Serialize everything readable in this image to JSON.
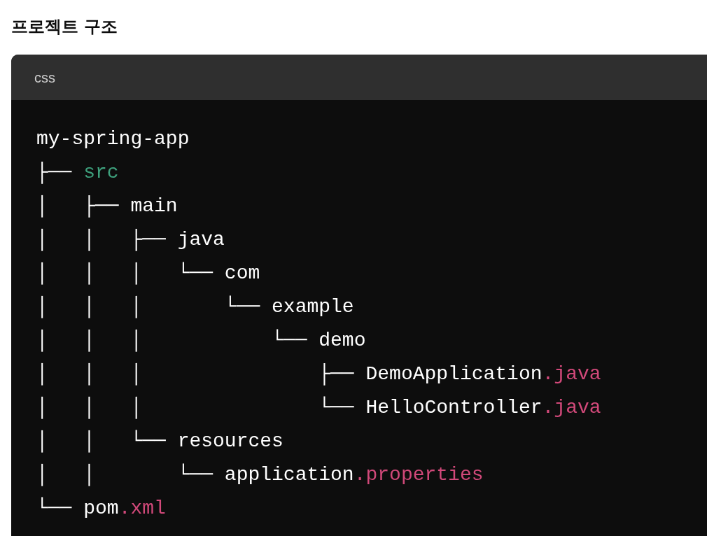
{
  "heading": "프로젝트 구조",
  "code_block": {
    "language": "css",
    "lines": [
      [
        {
          "text": "my-spring-app",
          "kind": "plain"
        }
      ],
      [
        {
          "text": "├── ",
          "kind": "plain"
        },
        {
          "text": "src",
          "kind": "selector"
        }
      ],
      [
        {
          "text": "│   ├── main",
          "kind": "plain"
        }
      ],
      [
        {
          "text": "│   │   ├── java",
          "kind": "plain"
        }
      ],
      [
        {
          "text": "│   │   │   └── com",
          "kind": "plain"
        }
      ],
      [
        {
          "text": "│   │   │       └── example",
          "kind": "plain"
        }
      ],
      [
        {
          "text": "│   │   │           └── demo",
          "kind": "plain"
        }
      ],
      [
        {
          "text": "│   │   │               ├── DemoApplication",
          "kind": "plain"
        },
        {
          "text": ".java",
          "kind": "class"
        }
      ],
      [
        {
          "text": "│   │   │               └── HelloController",
          "kind": "plain"
        },
        {
          "text": ".java",
          "kind": "class"
        }
      ],
      [
        {
          "text": "│   │   └── resources",
          "kind": "plain"
        }
      ],
      [
        {
          "text": "│   │       └── application",
          "kind": "plain"
        },
        {
          "text": ".properties",
          "kind": "class"
        }
      ],
      [
        {
          "text": "└── pom",
          "kind": "plain"
        },
        {
          "text": ".xml",
          "kind": "class"
        }
      ]
    ]
  }
}
